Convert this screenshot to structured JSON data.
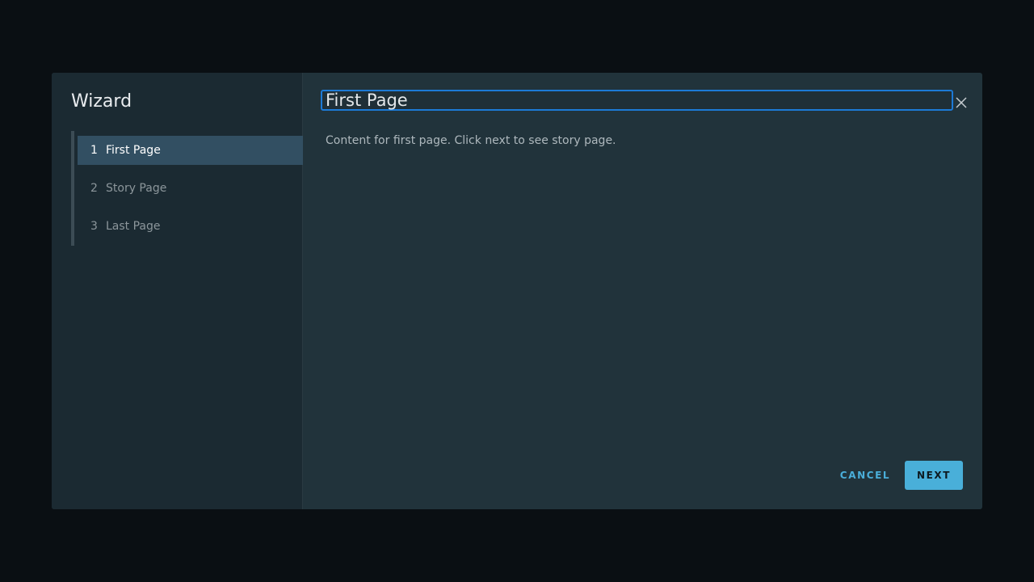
{
  "wizard": {
    "title": "Wizard",
    "steps": [
      {
        "number": "1",
        "label": "First Page",
        "active": true
      },
      {
        "number": "2",
        "label": "Story Page",
        "active": false
      },
      {
        "number": "3",
        "label": "Last Page",
        "active": false
      }
    ]
  },
  "page": {
    "title": "First Page",
    "content": "Content for first page. Click next to see story page."
  },
  "footer": {
    "cancel_label": "CANCEL",
    "next_label": "NEXT"
  },
  "icons": {
    "close": "close-icon"
  },
  "colors": {
    "accent": "#49afd9",
    "active_step_bg": "#324f62",
    "focus_border": "#1c7ad6"
  }
}
